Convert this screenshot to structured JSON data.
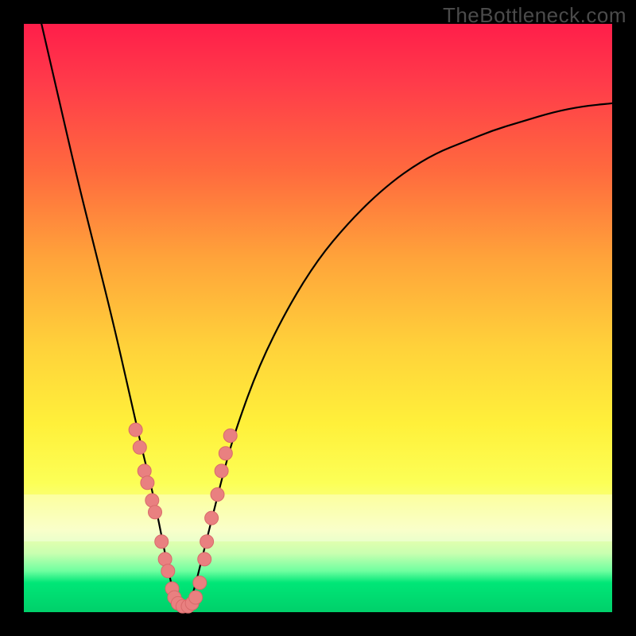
{
  "watermark": "TheBottleneck.com",
  "chart_data": {
    "type": "line",
    "title": "",
    "xlabel": "",
    "ylabel": "",
    "xlim": [
      0,
      100
    ],
    "ylim": [
      0,
      100
    ],
    "grid": false,
    "legend": false,
    "series": [
      {
        "name": "bottleneck-curve",
        "note": "V-shaped curve; minimum (0% bottleneck) near x≈27. Values are percentages read from vertical position (top=100, bottom=0).",
        "x": [
          3,
          6,
          9,
          12,
          15,
          18,
          20,
          22,
          24,
          25,
          26,
          27,
          28,
          29,
          30,
          32,
          34,
          36,
          40,
          45,
          50,
          55,
          60,
          65,
          70,
          75,
          80,
          85,
          90,
          95,
          100
        ],
        "values": [
          100,
          87,
          74,
          62,
          50,
          37,
          28,
          20,
          10,
          5,
          1,
          0,
          1,
          4,
          8,
          16,
          24,
          31,
          42,
          52,
          60,
          66,
          71,
          75,
          78,
          80,
          82,
          83.5,
          85,
          86,
          86.5
        ]
      }
    ],
    "markers": {
      "name": "highlighted-points",
      "note": "Salmon dots clustered near the bottom of the V on both branches.",
      "points": [
        {
          "x": 19.0,
          "y": 31
        },
        {
          "x": 19.7,
          "y": 28
        },
        {
          "x": 20.5,
          "y": 24
        },
        {
          "x": 21.0,
          "y": 22
        },
        {
          "x": 21.8,
          "y": 19
        },
        {
          "x": 22.3,
          "y": 17
        },
        {
          "x": 23.4,
          "y": 12
        },
        {
          "x": 24.0,
          "y": 9
        },
        {
          "x": 24.5,
          "y": 7
        },
        {
          "x": 25.2,
          "y": 4
        },
        {
          "x": 25.6,
          "y": 2.5
        },
        {
          "x": 26.2,
          "y": 1.5
        },
        {
          "x": 27.0,
          "y": 1
        },
        {
          "x": 27.9,
          "y": 1
        },
        {
          "x": 28.6,
          "y": 1.5
        },
        {
          "x": 29.2,
          "y": 2.5
        },
        {
          "x": 29.9,
          "y": 5
        },
        {
          "x": 30.7,
          "y": 9
        },
        {
          "x": 31.1,
          "y": 12
        },
        {
          "x": 31.9,
          "y": 16
        },
        {
          "x": 32.9,
          "y": 20
        },
        {
          "x": 33.6,
          "y": 24
        },
        {
          "x": 34.3,
          "y": 27
        },
        {
          "x": 35.1,
          "y": 30
        }
      ]
    },
    "band": {
      "from_y": 12,
      "to_y": 20,
      "note": "faint lighter horizontal band"
    }
  }
}
